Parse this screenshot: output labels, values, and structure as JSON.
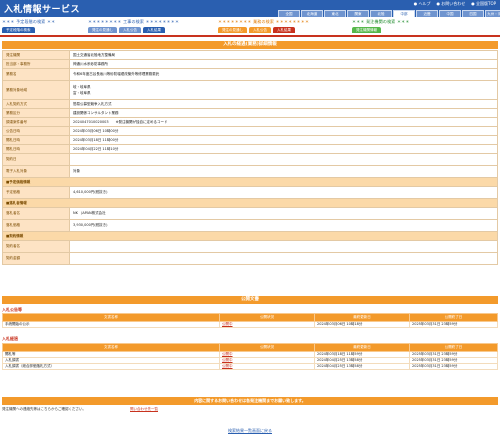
{
  "header": {
    "logo": "入札情報サービス",
    "links": [
      "● ヘルプ",
      "● お問い合わせ",
      "● 全国版TOP"
    ],
    "regions": [
      "全国",
      "北海道",
      "東北",
      "関東",
      "北陸",
      "中部",
      "近畿",
      "中国",
      "四国",
      "九州・沖縄"
    ],
    "active_region": 5
  },
  "nav": {
    "groups": [
      {
        "title": "＊＊＊ 予定段階の検索 ＊＊",
        "color": "blue",
        "tabs": [
          "予定段階の検索"
        ]
      },
      {
        "title": "＊＊＊＊＊＊＊＊ 工事の検索 ＊＊＊＊＊＊＊＊",
        "color": "blue",
        "tabs": [
          "発注の見通し",
          "入札公告",
          "入札結果"
        ]
      },
      {
        "title": "＊＊＊＊＊＊＊＊ 業務の検索 ＊＊＊＊＊＊＊＊",
        "color": "orange",
        "tabs": [
          "発注の見通し",
          "入札公告",
          "入札結果"
        ]
      },
      {
        "title": "＊＊＊ 発注機関の検索 ＊＊＊",
        "color": "green",
        "tabs": [
          "発注機関情報"
        ]
      }
    ]
  },
  "section_title": "入札の経過(業務)詳細情報",
  "details": [
    {
      "label": "発注機関",
      "value": "国土交通省北陸地方整備局"
    },
    {
      "label": "担当部・事務所",
      "value": "神通川水系砂防事務所"
    },
    {
      "label": "業務名",
      "value": "令和6年度古谷長坂川等砂防堰堤改築外等修理業務委託"
    },
    {
      "label": "業務対象地域",
      "value": "岐・岐阜県\n富・岐阜県"
    },
    {
      "label": "入札契約方式",
      "value": "簡易公募型競争入札方式"
    },
    {
      "label": "業務区分",
      "value": "建設関係コンサルタント業務"
    },
    {
      "label": "調達案件番号",
      "value": "2024047010020003　　※発注機関が独自に定めるコード"
    },
    {
      "label": "公告日時",
      "value": "2024年03月06日 10時00分"
    },
    {
      "label": "開札日時",
      "value": "2024年03月18日 11時00分"
    },
    {
      "label": "開札日時",
      "value": "2024年04月22日 11時10分"
    },
    {
      "label": "契約日",
      "value": ""
    },
    {
      "label": "電子入札対象",
      "value": "対象"
    }
  ],
  "sub1": "■予定価格情報",
  "price": {
    "label": "予定価格",
    "value": "4,610,000円(税抜き)"
  },
  "sub2": "■落札者情報",
  "winner": [
    {
      "label": "落札者名",
      "value": "NK　JAPAN株式会社"
    },
    {
      "label": "落札価格",
      "value": "3,930,000円(税抜き)"
    }
  ],
  "sub3": "■契約情報",
  "contract": [
    {
      "label": "契約者名",
      "value": ""
    },
    {
      "label": "契約金額",
      "value": ""
    }
  ],
  "docs_title": "公開文書",
  "koukoku": {
    "title": "入札公告等",
    "headers": [
      "文書名称",
      "公開状況",
      "最終更新日",
      "公開終了日"
    ],
    "rows": [
      [
        "手続開始の公示",
        "公開中",
        "2024年03月06日 10時18分",
        "2025年03月31日 23時59分"
      ]
    ]
  },
  "keika": {
    "title": "入札経過",
    "headers": [
      "文書名称",
      "公開状況",
      "最終更新日",
      "公開終了日"
    ],
    "rows": [
      [
        "開札等",
        "公開中",
        "2024年03月18日 11時59分",
        "2025年03月31日 23時59分"
      ],
      [
        "入札調書",
        "公開中",
        "2024年04月25日 13時58分",
        "2025年03月31日 23時59分"
      ],
      [
        "入札調書（総合評価落札方式）",
        "公開中",
        "2024年04月25日 13時58分",
        "2025年03月31日 23時59分"
      ]
    ]
  },
  "notice_bar": "内容に関するお問い合わせは各発注機関までお願い致します。",
  "notice_text": "発注機関への連絡先等はこちらからご確認ください。",
  "notice_link": "問い合わせ先一覧",
  "back_link": "検索結果一覧画面に戻る"
}
